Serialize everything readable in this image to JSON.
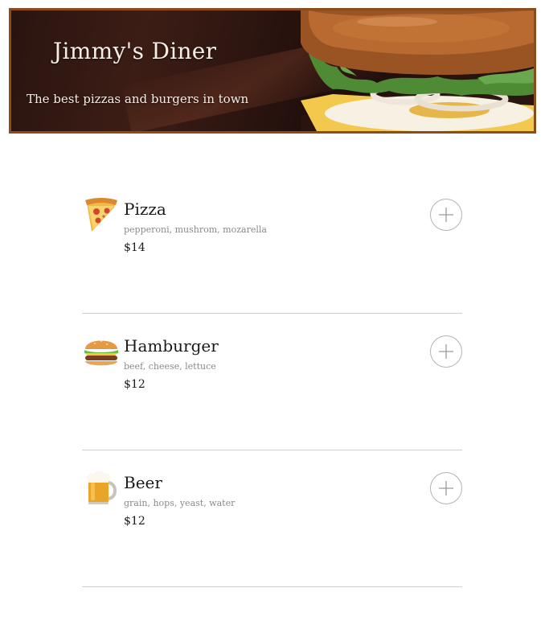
{
  "header": {
    "title": "Jimmy's Diner",
    "tagline": "The best pizzas and burgers in town"
  },
  "menu": {
    "items": [
      {
        "name": "Pizza",
        "ingredients": "pepperoni, mushrom, mozarella",
        "price": "$14",
        "icon": "pizza-icon"
      },
      {
        "name": "Hamburger",
        "ingredients": "beef, cheese, lettuce",
        "price": "$12",
        "icon": "hamburger-icon"
      },
      {
        "name": "Beer",
        "ingredients": "grain, hops, yeast, water",
        "price": "$12",
        "icon": "beer-icon"
      }
    ],
    "add_icon": "plus-icon"
  },
  "colors": {
    "header_border": "#8b4b1b",
    "divider": "#cfcfcf",
    "ingredients_text": "#8a8a8a",
    "button_border": "#b3b3b3"
  }
}
